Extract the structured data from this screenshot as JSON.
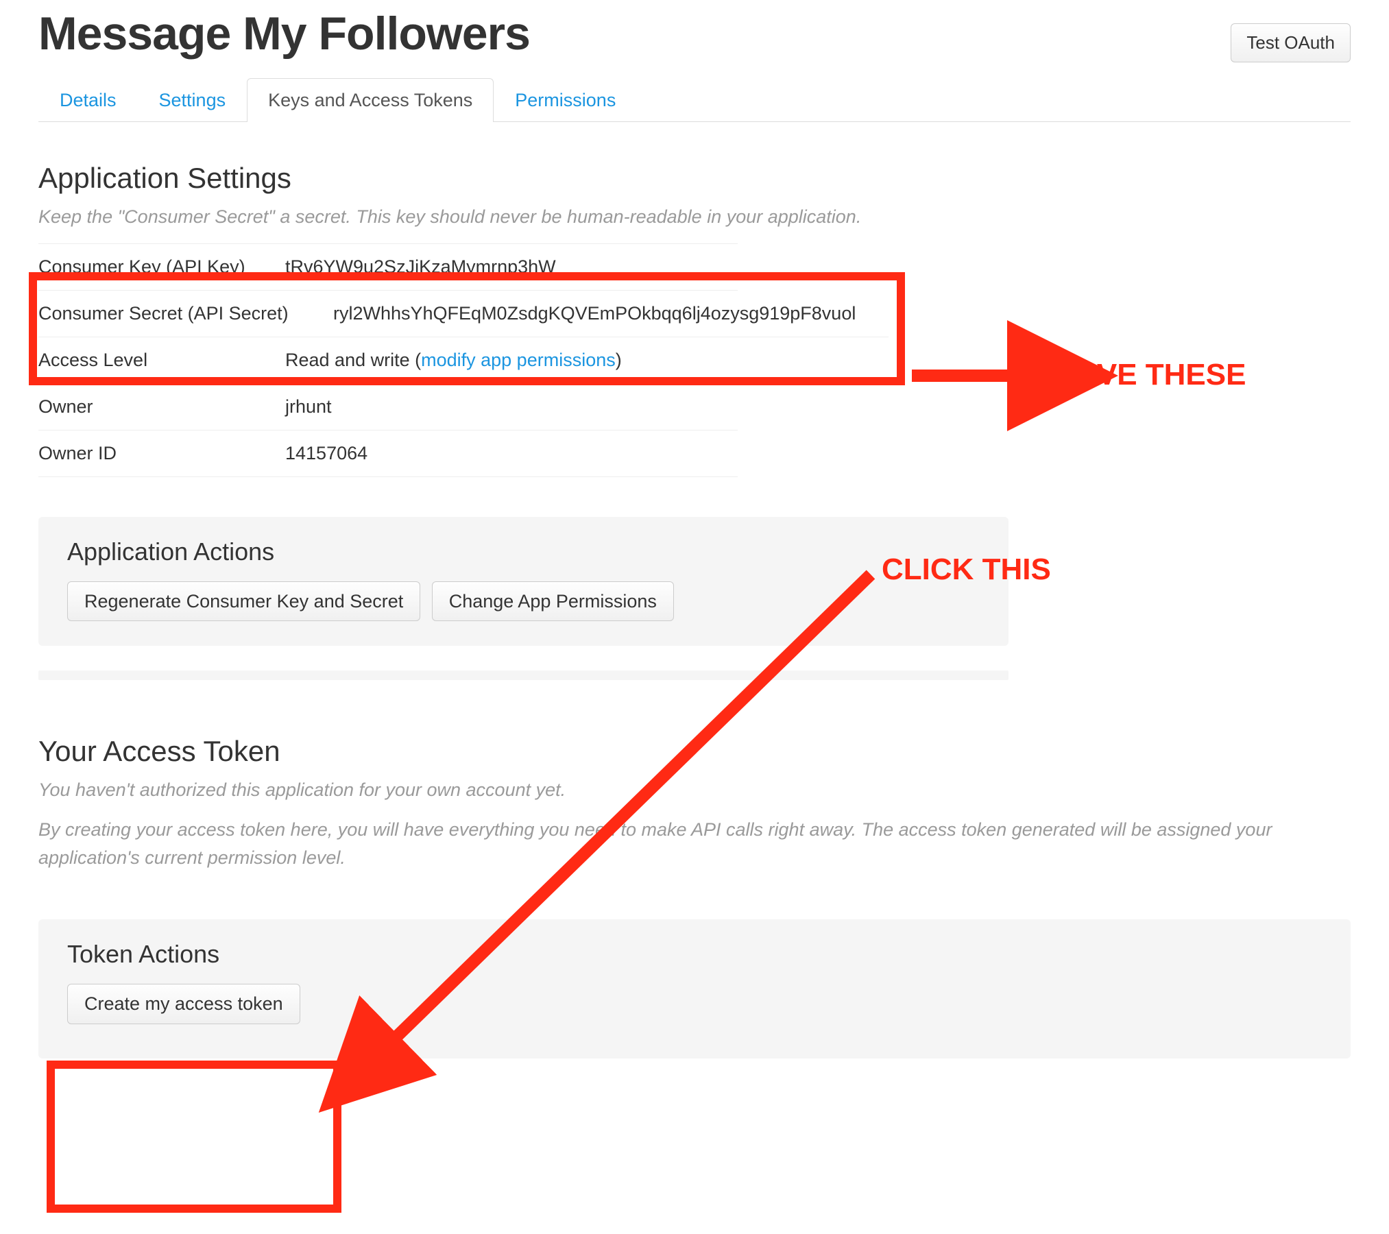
{
  "header": {
    "app_name": "Message My Followers",
    "test_oauth_label": "Test OAuth"
  },
  "tabs": {
    "details": "Details",
    "settings": "Settings",
    "keys": "Keys and Access Tokens",
    "permissions": "Permissions"
  },
  "app_settings": {
    "title": "Application Settings",
    "help": "Keep the \"Consumer Secret\" a secret. This key should never be human-readable in your application.",
    "rows": {
      "consumer_key_label": "Consumer Key (API Key)",
      "consumer_key_value": "tRv6YW9u2SzJjKzaMymrnp3hW",
      "consumer_secret_label": "Consumer Secret (API Secret)",
      "consumer_secret_value": "ryl2WhhsYhQFEqM0ZsdgKQVEmPOkbqq6lj4ozysg919pF8vuol",
      "access_level_label": "Access Level",
      "access_level_value_prefix": "Read and write (",
      "access_level_link": "modify app permissions",
      "access_level_value_suffix": ")",
      "owner_label": "Owner",
      "owner_value": "jrhunt",
      "owner_id_label": "Owner ID",
      "owner_id_value": "14157064"
    }
  },
  "app_actions": {
    "title": "Application Actions",
    "regenerate_label": "Regenerate Consumer Key and Secret",
    "change_perms_label": "Change App Permissions"
  },
  "access_token": {
    "title": "Your Access Token",
    "help1": "You haven't authorized this application for your own account yet.",
    "help2": "By creating your access token here, you will have everything you need to make API calls right away. The access token generated will be assigned your application's current permission level."
  },
  "token_actions": {
    "title": "Token Actions",
    "create_label": "Create my access token"
  },
  "annotations": {
    "save_these": "SAVE THESE",
    "click_this": "CLICK THIS"
  }
}
